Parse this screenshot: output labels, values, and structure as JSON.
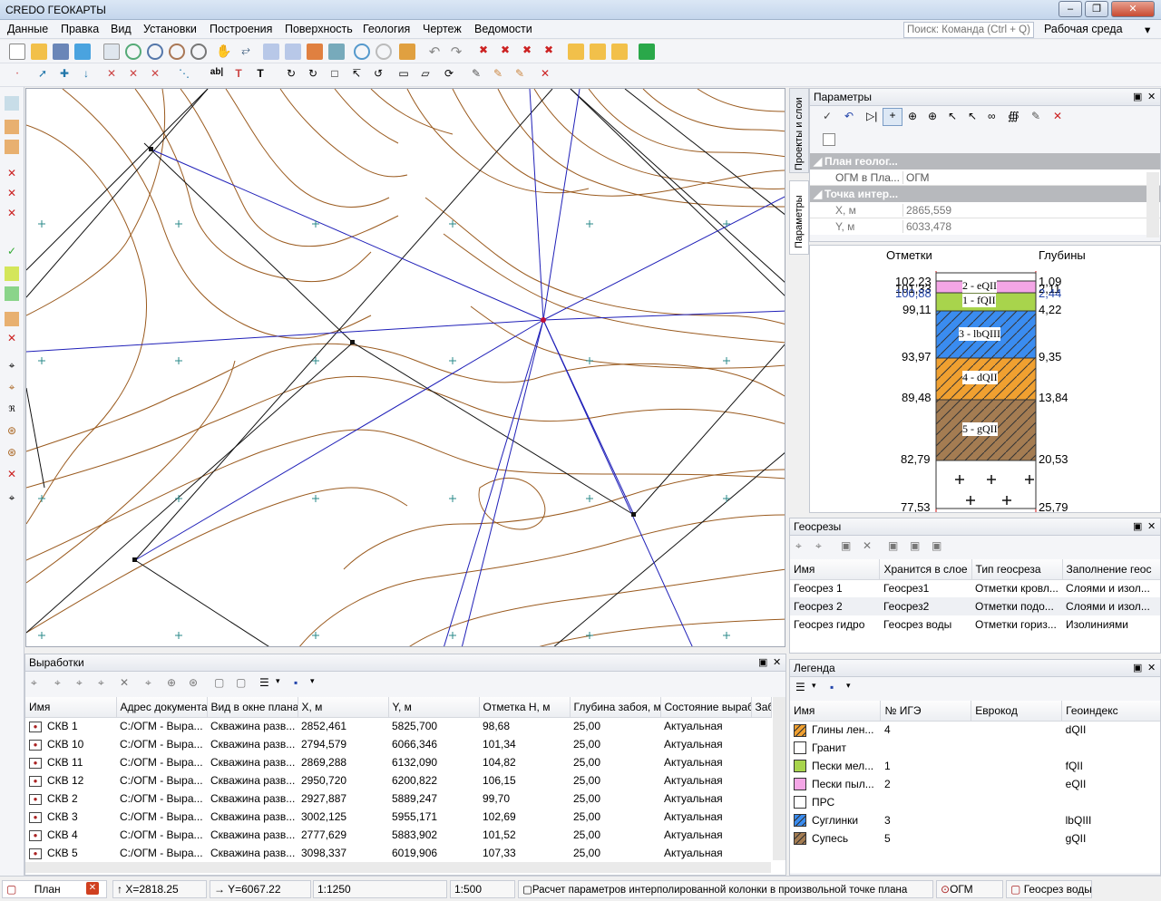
{
  "window": {
    "title": "CREDO ГЕОКАРТЫ"
  },
  "menu": {
    "items": [
      "Данные",
      "Правка",
      "Вид",
      "Установки",
      "Построения",
      "Поверхность",
      "Геология",
      "Чертеж",
      "Ведомости"
    ],
    "search_placeholder": "Поиск: Команда (Ctrl + Q)",
    "workspace": "Рабочая среда"
  },
  "side_tabs": {
    "projects": "Проекты и слои",
    "params": "Параметры"
  },
  "params": {
    "title": "Параметры",
    "section1": "План геолог...",
    "row1_label": "ОГМ в Пла...",
    "row1_value": "ОГМ",
    "section2": "Точка интер...",
    "x_label": "X, м",
    "x_value": "2865,559",
    "y_label": "Y, м",
    "y_value": "6033,478"
  },
  "column": {
    "head_left": "Отметки",
    "head_right": "Глубины",
    "elev_labels": [
      "102,23",
      "101,33",
      "100,88",
      "99,11",
      "93,97",
      "89,48",
      "82,79",
      "77,53"
    ],
    "depth_labels": [
      "1,09",
      "2,11",
      "2,44",
      "4,22",
      "9,35",
      "13,84",
      "20,53",
      "25,79"
    ],
    "layers": [
      "2 - eQII",
      "1 - fQII",
      "3 - lbQIII",
      "4 - dQII",
      "5 - gQII"
    ]
  },
  "geosections": {
    "title": "Геосрезы",
    "columns": [
      "Имя",
      "Хранится в слое",
      "Тип геосреза",
      "Заполнение геос"
    ],
    "rows": [
      [
        "Геосрез 1",
        "Геосрез1",
        "Отметки кровл...",
        "Слоями и изол..."
      ],
      [
        "Геосрез 2",
        "Геосрез2",
        "Отметки подо...",
        "Слоями и изол..."
      ],
      [
        "Геосрез гидро",
        "Геосрез воды",
        "Отметки гориз...",
        "Изолиниями"
      ]
    ]
  },
  "legend": {
    "title": "Легенда",
    "columns": [
      "Имя",
      "№ ИГЭ",
      "Еврокод",
      "Геоиндекс"
    ],
    "rows": [
      {
        "name": "Глины лен...",
        "ige": "4",
        "euro": "",
        "geo": "dQII",
        "color": "#f0a030",
        "hatch": true
      },
      {
        "name": "Гранит",
        "ige": "",
        "euro": "",
        "geo": "",
        "color": "#ffffff",
        "hatch": false
      },
      {
        "name": "Пески мел...",
        "ige": "1",
        "euro": "",
        "geo": "fQII",
        "color": "#a8d44c",
        "hatch": false
      },
      {
        "name": "Пески пыл...",
        "ige": "2",
        "euro": "",
        "geo": "eQII",
        "color": "#f4a6e6",
        "hatch": false
      },
      {
        "name": "ПРС",
        "ige": "",
        "euro": "",
        "geo": "",
        "color": "#ffffff",
        "hatch": false
      },
      {
        "name": "Суглинки",
        "ige": "3",
        "euro": "",
        "geo": "lbQIII",
        "color": "#3a8cf0",
        "hatch": true
      },
      {
        "name": "Супесь",
        "ige": "5",
        "euro": "",
        "geo": "gQII",
        "color": "#a47c52",
        "hatch": true
      }
    ]
  },
  "workings": {
    "title": "Выработки",
    "columns": [
      "Имя",
      "Адрес документа",
      "Вид в окне плана",
      "X, м",
      "Y, м",
      "Отметка H, м",
      "Глубина забоя, м",
      "Состояние выработки",
      "Заб"
    ],
    "rows": [
      [
        "СКВ 1",
        "С:/ОГМ - Выра...",
        "Скважина разв...",
        "2852,461",
        "5825,700",
        "98,68",
        "25,00",
        "Актуальная"
      ],
      [
        "СКВ 10",
        "С:/ОГМ - Выра...",
        "Скважина разв...",
        "2794,579",
        "6066,346",
        "101,34",
        "25,00",
        "Актуальная"
      ],
      [
        "СКВ 11",
        "С:/ОГМ - Выра...",
        "Скважина разв...",
        "2869,288",
        "6132,090",
        "104,82",
        "25,00",
        "Актуальная"
      ],
      [
        "СКВ 12",
        "С:/ОГМ - Выра...",
        "Скважина разв...",
        "2950,720",
        "6200,822",
        "106,15",
        "25,00",
        "Актуальная"
      ],
      [
        "СКВ 2",
        "С:/ОГМ - Выра...",
        "Скважина разв...",
        "2927,887",
        "5889,247",
        "99,70",
        "25,00",
        "Актуальная"
      ],
      [
        "СКВ 3",
        "С:/ОГМ - Выра...",
        "Скважина разв...",
        "3002,125",
        "5955,171",
        "102,69",
        "25,00",
        "Актуальная"
      ],
      [
        "СКВ 4",
        "С:/ОГМ - Выра...",
        "Скважина разв...",
        "2777,629",
        "5883,902",
        "101,52",
        "25,00",
        "Актуальная"
      ],
      [
        "СКВ 5",
        "С:/ОГМ - Выра...",
        "Скважина разв...",
        "3098,337",
        "6019,906",
        "107,33",
        "25,00",
        "Актуальная"
      ]
    ]
  },
  "status": {
    "tab": "План",
    "x": "X=2818.25",
    "y": "Y=6067.22",
    "scale1": "1:1250",
    "scale2": "1:500",
    "message": "Расчет параметров интерполированной колонки в произвольной точке плана",
    "layer1": "ОГМ",
    "layer2": "Геосрез воды"
  },
  "colors": {
    "contour": "#9a5a1e",
    "section_line": "#1f1fb8",
    "grid_mark": "#2a8a8a"
  }
}
